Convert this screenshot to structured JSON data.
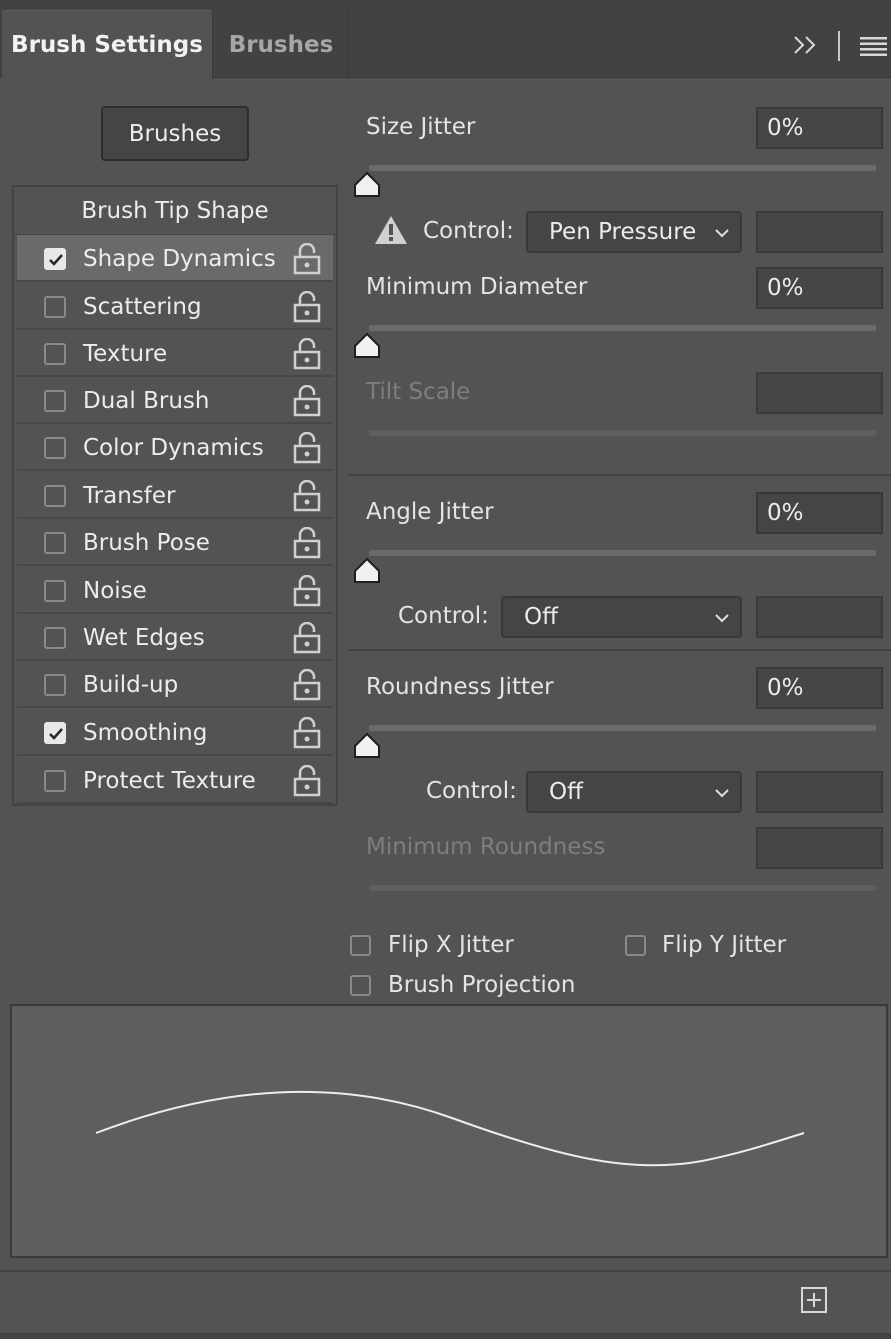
{
  "tabs": {
    "active": "Brush Settings",
    "inactive": "Brushes"
  },
  "icons": {
    "expand": "double-chevron-right-icon",
    "menu": "hamburger-menu-icon",
    "lock": "unlocked-padlock-icon",
    "warning": "warning-triangle-icon",
    "new": "new-preset-plus-icon",
    "dropdown": "chevron-down-icon",
    "checkbox_check": "checkmark-icon"
  },
  "left": {
    "brushes_button": "Brushes",
    "tip_shape": "Brush Tip Shape",
    "items": [
      {
        "label": "Shape Dynamics",
        "checked": true,
        "selected": true
      },
      {
        "label": "Scattering",
        "checked": false
      },
      {
        "label": "Texture",
        "checked": false
      },
      {
        "label": "Dual Brush",
        "checked": false
      },
      {
        "label": "Color Dynamics",
        "checked": false
      },
      {
        "label": "Transfer",
        "checked": false
      },
      {
        "label": "Brush Pose",
        "checked": false
      },
      {
        "label": "Noise",
        "checked": false
      },
      {
        "label": "Wet Edges",
        "checked": false
      },
      {
        "label": "Build-up",
        "checked": false
      },
      {
        "label": "Smoothing",
        "checked": true
      },
      {
        "label": "Protect Texture",
        "checked": false
      }
    ]
  },
  "right": {
    "size_jitter": {
      "label": "Size Jitter",
      "value": "0%",
      "slider": 0
    },
    "size_control": {
      "label": "Control:",
      "value": "Pen Pressure"
    },
    "min_diameter": {
      "label": "Minimum Diameter",
      "value": "0%",
      "slider": 0
    },
    "tilt_scale": {
      "label": "Tilt Scale"
    },
    "angle_jitter": {
      "label": "Angle Jitter",
      "value": "0%",
      "slider": 0
    },
    "angle_control": {
      "label": "Control:",
      "value": "Off"
    },
    "roundness_jitter": {
      "label": "Roundness Jitter",
      "value": "0%",
      "slider": 0
    },
    "roundness_control": {
      "label": "Control:",
      "value": "Off"
    },
    "min_roundness": {
      "label": "Minimum Roundness"
    },
    "flip_x": {
      "label": "Flip X Jitter",
      "checked": false
    },
    "flip_y": {
      "label": "Flip Y Jitter",
      "checked": false
    },
    "projection": {
      "label": "Brush Projection",
      "checked": false
    }
  },
  "colors": {
    "panel": "#535353",
    "tabbar": "#424242",
    "field": "#454545",
    "selected_row": "#6a6a6a",
    "preview": "#5e5e5e",
    "text": "#e6e6e6",
    "dim_text": "#7e7e7e"
  }
}
